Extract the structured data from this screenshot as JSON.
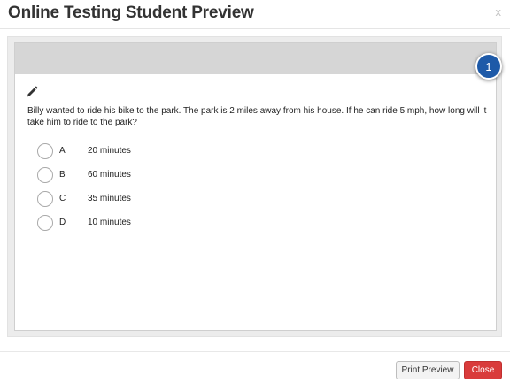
{
  "dialog": {
    "title": "Online Testing Student Preview",
    "close_glyph": "x"
  },
  "question": {
    "number": "1",
    "edit_icon": "pencil-icon",
    "text": "Billy wanted to ride his bike to the park. The park is 2 miles away from his house. If he can ride 5 mph, how long will it take him to ride to the park?",
    "options": [
      {
        "letter": "A",
        "text": "20 minutes"
      },
      {
        "letter": "B",
        "text": "60 minutes"
      },
      {
        "letter": "C",
        "text": "35 minutes"
      },
      {
        "letter": "D",
        "text": "10 minutes"
      }
    ]
  },
  "footer": {
    "print_preview_label": "Print Preview",
    "close_label": "Close"
  },
  "colors": {
    "badge": "#1e5aa8",
    "close_button": "#d93b3b",
    "question_header": "#d6d6d6"
  }
}
